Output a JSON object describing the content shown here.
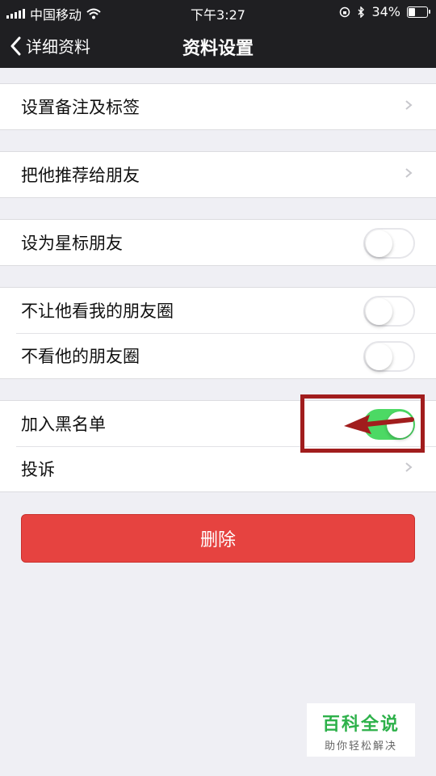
{
  "status_bar": {
    "carrier": "中国移动",
    "time": "下午3:27",
    "battery": "34%"
  },
  "nav": {
    "back_label": "详细资料",
    "title": "资料设置"
  },
  "rows": {
    "remark": "设置备注及标签",
    "recommend": "把他推荐给朋友",
    "star": "设为星标朋友",
    "hide_my_moments": "不让他看我的朋友圈",
    "hide_his_moments": "不看他的朋友圈",
    "blacklist": "加入黑名单",
    "complain": "投诉"
  },
  "toggles": {
    "star": false,
    "hide_my_moments": false,
    "hide_his_moments": false,
    "blacklist": true
  },
  "delete_label": "删除",
  "watermark": {
    "title": "百科全说",
    "subtitle": "助你轻松解决"
  },
  "colors": {
    "toggle_on": "#4cd964",
    "delete": "#e64340",
    "annotation": "#a11d1d"
  }
}
